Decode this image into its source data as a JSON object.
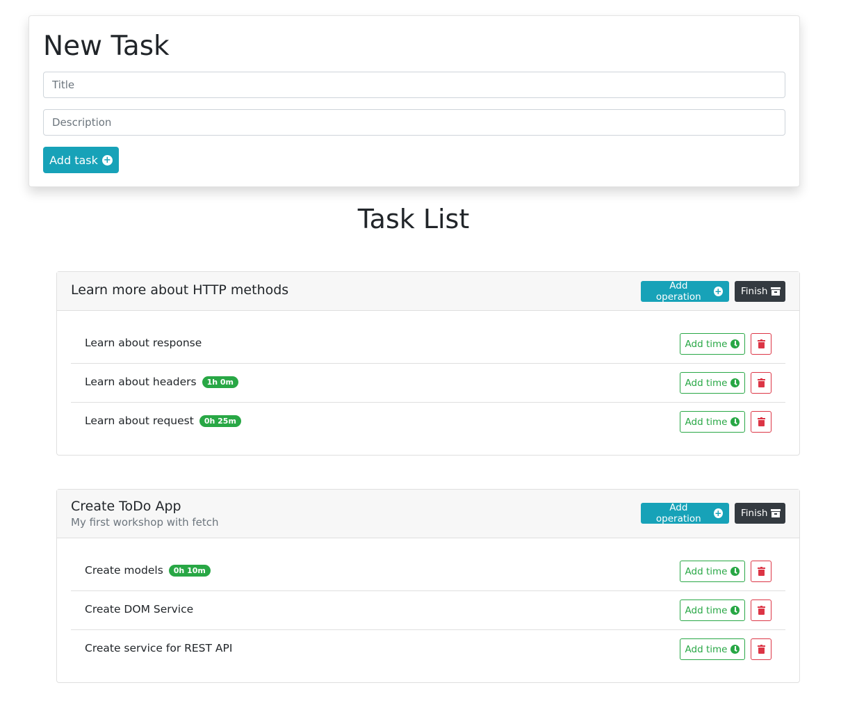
{
  "new_task": {
    "heading": "New Task",
    "title_placeholder": "Title",
    "description_placeholder": "Description",
    "add_task_label": "Add task"
  },
  "task_list_heading": "Task List",
  "colors": {
    "info": "#17a2b8",
    "dark": "#343a40",
    "success": "#28a745",
    "danger": "#dc3545"
  },
  "icons": {
    "add": "plus-circle-icon",
    "finish": "archive-icon",
    "time": "clock-icon",
    "delete": "trash-icon"
  },
  "tasks": [
    {
      "title": "Learn more about HTTP methods",
      "description": "",
      "add_operation_label": "Add operation",
      "finish_label": "Finish",
      "operations": [
        {
          "label": "Learn about response",
          "time": "",
          "add_time_label": "Add time"
        },
        {
          "label": "Learn about headers",
          "time": "1h 0m",
          "add_time_label": "Add time"
        },
        {
          "label": "Learn about request",
          "time": "0h 25m",
          "add_time_label": "Add time"
        }
      ]
    },
    {
      "title": "Create ToDo App",
      "description": "My first workshop with fetch",
      "add_operation_label": "Add operation",
      "finish_label": "Finish",
      "operations": [
        {
          "label": "Create models",
          "time": "0h 10m",
          "add_time_label": "Add time"
        },
        {
          "label": "Create DOM Service",
          "time": "",
          "add_time_label": "Add time"
        },
        {
          "label": "Create service for REST API",
          "time": "",
          "add_time_label": "Add time"
        }
      ]
    }
  ]
}
